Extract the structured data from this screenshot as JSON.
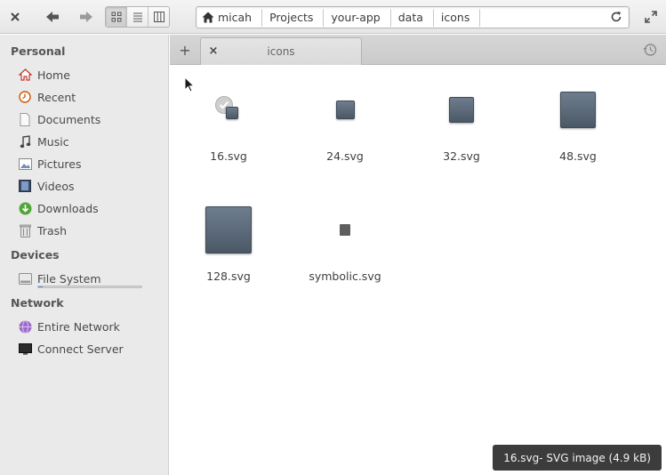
{
  "header": {
    "close_icon": "close-icon",
    "back_icon": "arrow-left-icon",
    "forward_icon": "arrow-right-icon",
    "view_modes": [
      "icon-view",
      "list-view",
      "column-view"
    ],
    "active_view": "icon-view",
    "breadcrumbs": [
      "micah",
      "Projects",
      "your-app",
      "data",
      "icons"
    ],
    "reload_icon": "reload-icon",
    "fullscreen_icon": "fullscreen-icon"
  },
  "sidebar": {
    "personal_heading": "Personal",
    "personal": [
      {
        "label": "Home",
        "icon": "home-icon"
      },
      {
        "label": "Recent",
        "icon": "recent-icon"
      },
      {
        "label": "Documents",
        "icon": "documents-icon"
      },
      {
        "label": "Music",
        "icon": "music-icon"
      },
      {
        "label": "Pictures",
        "icon": "pictures-icon"
      },
      {
        "label": "Videos",
        "icon": "videos-icon"
      },
      {
        "label": "Downloads",
        "icon": "downloads-icon"
      },
      {
        "label": "Trash",
        "icon": "trash-icon"
      }
    ],
    "devices_heading": "Devices",
    "devices": [
      {
        "label": "File System",
        "icon": "drive-icon",
        "usage_fraction": 0.04
      }
    ],
    "network_heading": "Network",
    "network": [
      {
        "label": "Entire Network",
        "icon": "network-icon"
      },
      {
        "label": "Connect Server",
        "icon": "server-icon"
      }
    ]
  },
  "tabs": {
    "add_label": "+",
    "close_label": "×",
    "active_tab_label": "icons"
  },
  "files": [
    {
      "name": "16.svg",
      "selected": true
    },
    {
      "name": "24.svg"
    },
    {
      "name": "32.svg"
    },
    {
      "name": "48.svg"
    },
    {
      "name": "128.svg"
    },
    {
      "name": "symbolic.svg"
    }
  ],
  "status": {
    "text": "16.svg- SVG image (4.9 kB)"
  },
  "colors": {
    "sidebar_bg": "#eaeaea",
    "headerbar_bg": "#e9e9e9",
    "icon_fill": "#56636f",
    "status_bg": "#3c3c3c"
  }
}
